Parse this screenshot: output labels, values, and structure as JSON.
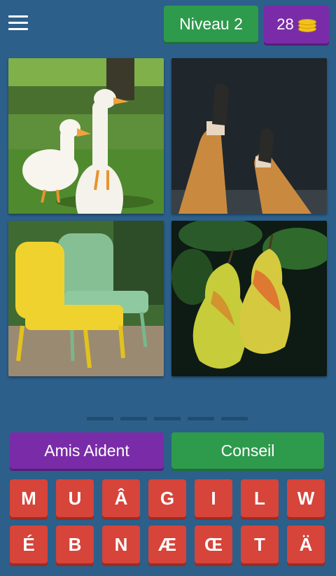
{
  "header": {
    "menu_icon": "hamburger-menu-icon",
    "level_label": "Niveau 2",
    "coins": "28",
    "coin_icon": "coin-stack-icon"
  },
  "images": [
    {
      "name": "ducks"
    },
    {
      "name": "legs-in-trousers"
    },
    {
      "name": "garden-chairs"
    },
    {
      "name": "pears"
    }
  ],
  "answer_slots": 5,
  "buttons": {
    "help_label": "Amis Aident",
    "hint_label": "Conseil"
  },
  "letters": {
    "row1": [
      "M",
      "U",
      "Â",
      "G",
      "I",
      "L",
      "W"
    ],
    "row2": [
      "É",
      "B",
      "N",
      "Æ",
      "Œ",
      "T",
      "Ä"
    ]
  },
  "colors": {
    "background": "#2c5f8a",
    "green": "#2e9a4c",
    "purple": "#7a2ca8",
    "key_red": "#d6443a"
  }
}
